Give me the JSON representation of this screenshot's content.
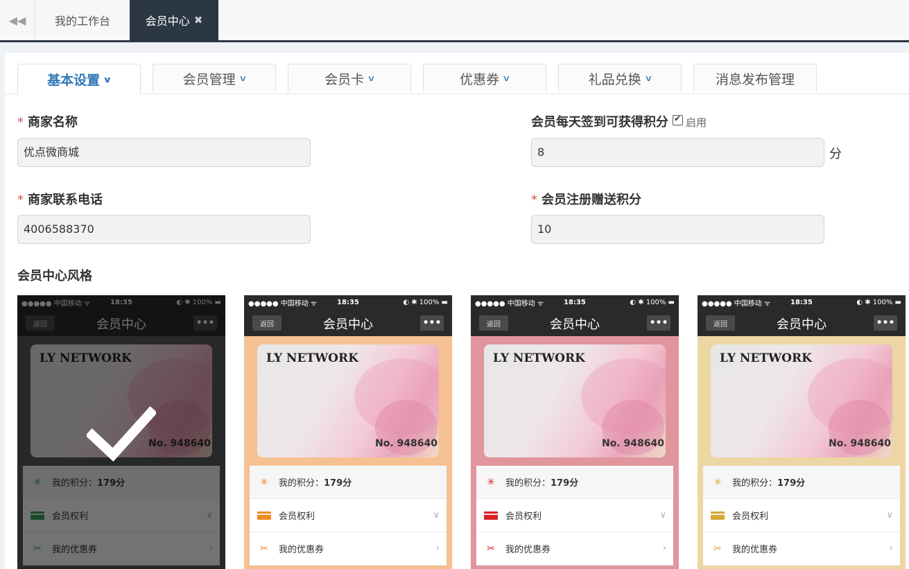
{
  "topbar": {
    "tabs": [
      {
        "label": "我的工作台"
      },
      {
        "label": "会员中心",
        "close": "✖"
      }
    ]
  },
  "subtabs": [
    {
      "label": "基本设置",
      "active": true,
      "has_dropdown": true
    },
    {
      "label": "会员管理",
      "has_dropdown": true
    },
    {
      "label": "会员卡",
      "has_dropdown": true
    },
    {
      "label": "优惠券",
      "has_dropdown": true
    },
    {
      "label": "礼品兑换",
      "has_dropdown": true
    },
    {
      "label": "消息发布管理",
      "has_dropdown": false
    }
  ],
  "form": {
    "merchant_name": {
      "label": "商家名称",
      "required": "*",
      "value": "优点微商城"
    },
    "merchant_phone": {
      "label": "商家联系电话",
      "required": "*",
      "value": "4006588370"
    },
    "daily_checkin_points": {
      "label": "会员每天签到可获得积分",
      "enable_label": "启用",
      "enabled": true,
      "value": "8",
      "unit": "分"
    },
    "register_bonus_points": {
      "label": "会员注册赠送积分",
      "required": "*",
      "value": "10"
    },
    "style_label": "会员中心风格"
  },
  "phone_common": {
    "carrier": "●●●●● 中国移动 ᯤ",
    "time": "18:35",
    "battery": "◐ ✱ 100% ▬",
    "back": "返回",
    "title": "会员中心",
    "more": "•••",
    "brand": "LY NETWORK",
    "card_no": "No. 948640",
    "points_label": "我的积分：",
    "points_value": "179分",
    "rights_label": "会员权利",
    "coupons_label": "我的优惠券"
  },
  "styles": [
    {
      "name": "dark",
      "bg": "#55595c",
      "icon_color": "#3aa55c",
      "selected": true
    },
    {
      "name": "orange",
      "bg": "#f5c193",
      "icon_color": "#f08a24",
      "selected": false
    },
    {
      "name": "red",
      "bg": "#e0969c",
      "icon_color": "#d9222a",
      "selected": false
    },
    {
      "name": "yellow",
      "bg": "#ecd6a3",
      "icon_color": "#d4a93a",
      "selected": false
    }
  ],
  "colors": {
    "accent": "#2f78b7",
    "dark": "#2b3743",
    "required": "#d9534f"
  }
}
